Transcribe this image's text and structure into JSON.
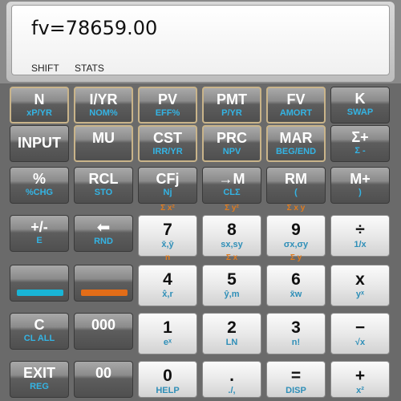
{
  "display": {
    "value": "fv=78659.00",
    "shift_ann": "SHIFT",
    "stats_ann": "STATS"
  },
  "rows": {
    "r1": [
      {
        "main": "N",
        "shift": "xP/YR"
      },
      {
        "main": "I/YR",
        "shift": "NOM%"
      },
      {
        "main": "PV",
        "shift": "EFF%"
      },
      {
        "main": "PMT",
        "shift": "P/YR"
      },
      {
        "main": "FV",
        "shift": "AMORT"
      },
      {
        "main": "K",
        "shift": "SWAP"
      }
    ],
    "r2": [
      {
        "main": "INPUT",
        "shift": ""
      },
      {
        "main": "MU",
        "shift": ""
      },
      {
        "main": "CST",
        "shift": "IRR/YR"
      },
      {
        "main": "PRC",
        "shift": "NPV"
      },
      {
        "main": "MAR",
        "shift": "BEG/END"
      },
      {
        "main": "Σ+",
        "shift": "Σ -"
      }
    ],
    "r3": [
      {
        "main": "%",
        "shift": "%CHG"
      },
      {
        "main": "RCL",
        "shift": "STO"
      },
      {
        "main": "CFj",
        "shift": "Nj"
      },
      {
        "main": "→M",
        "shift": "CLΣ"
      },
      {
        "main": "RM",
        "shift": "("
      },
      {
        "main": "M+",
        "shift": ")"
      }
    ],
    "r4": [
      {
        "main": "+/-",
        "shift": "E"
      },
      {
        "main": "⬅",
        "shift": "RND"
      },
      {
        "main": "7",
        "shift": "x̄,ȳ",
        "top": "Σ x²"
      },
      {
        "main": "8",
        "shift": "sx,sy",
        "top": "Σ y²"
      },
      {
        "main": "9",
        "shift": "σx,σy",
        "top": "Σ x y"
      },
      {
        "main": "÷",
        "shift": "1/x"
      }
    ],
    "r5": [
      {
        "main": "",
        "shift": ""
      },
      {
        "main": "",
        "shift": ""
      },
      {
        "main": "4",
        "shift": "x̂,r",
        "top": "n"
      },
      {
        "main": "5",
        "shift": "ŷ,m",
        "top": "Σ x"
      },
      {
        "main": "6",
        "shift": "x̄w",
        "top": "Σ y"
      },
      {
        "main": "x",
        "shift": "yˣ"
      }
    ],
    "r6": [
      {
        "main": "C",
        "shift": "CL ALL"
      },
      {
        "main": "000",
        "shift": ""
      },
      {
        "main": "1",
        "shift": "eˣ"
      },
      {
        "main": "2",
        "shift": "LN"
      },
      {
        "main": "3",
        "shift": "n!"
      },
      {
        "main": "−",
        "shift": "√x"
      }
    ],
    "r7": [
      {
        "main": "EXIT",
        "shift": "REG"
      },
      {
        "main": "00",
        "shift": ""
      },
      {
        "main": "0",
        "shift": "HELP"
      },
      {
        "main": ".",
        "shift": "./,"
      },
      {
        "main": "=",
        "shift": "DISP"
      },
      {
        "main": "+",
        "shift": "x²"
      }
    ]
  },
  "colors": {
    "shift_label": "#34b4e4",
    "alt_label": "#e07b1e",
    "cyan_bar": "#19b5d6",
    "orange_bar": "#e36d18"
  }
}
